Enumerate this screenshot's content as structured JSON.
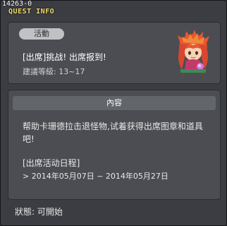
{
  "window": {
    "id_label": "14263-0",
    "title": "QUEST INFO"
  },
  "quest": {
    "badge": "活動",
    "name": "[出席]挑战! 出席报到!",
    "level": "建議等級: 13~17"
  },
  "content": {
    "header": "內容",
    "description": "帮助卡珊德拉击退怪物,试着获得出席图章和道具吧!",
    "schedule_title": "[出席活动日程]",
    "schedule_dates": "> 2014年05月07日 ~ 2014年05月27日"
  },
  "status": "狀態: 可開始",
  "icons": {
    "npc_avatar": "npc-cassandra-portrait"
  },
  "colors": {
    "title": "#f2d96a",
    "panel": "#4b4d52",
    "window": "#3b3d42"
  }
}
